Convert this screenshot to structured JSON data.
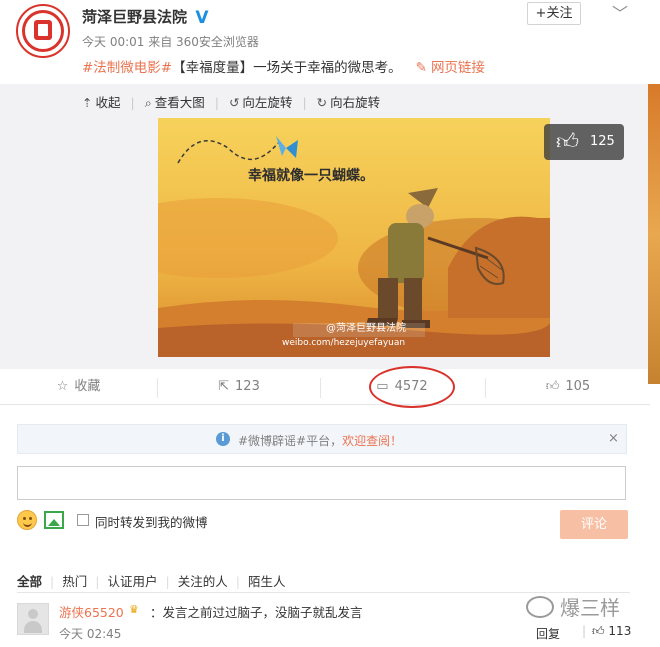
{
  "post": {
    "account_name": "菏泽巨野县法院",
    "verified_badge": "V",
    "meta": "今天 00:01 来自 360安全浏览器",
    "hashtag": "#法制微电影#",
    "text": "【幸福度量】一场关于幸福的微思考。",
    "link_label": "网页链接",
    "follow_label": "+关注",
    "more_icon": "chevron-down-icon"
  },
  "media_tools": {
    "collapse": "收起",
    "view_large": "查看大图",
    "rotate_left": "向左旋转",
    "rotate_right": "向右旋转"
  },
  "picture": {
    "caption": "幸福就像一只蝴蝶。",
    "watermark_name": "@菏泽巨野县法院",
    "watermark_url": "weibo.com/hezejuyefayuan",
    "like_count": "125"
  },
  "actions": {
    "favorite": "收藏",
    "repost_count": "123",
    "comment_count": "4572",
    "like_count": "105"
  },
  "comments": {
    "notice_text": "#微博辟谣#平台，",
    "notice_highlight": "欢迎查阅！",
    "close": "×",
    "repost_also": "同时转发到我的微博",
    "submit": "评论",
    "tabs": [
      "全部",
      "热门",
      "认证用户",
      "关注的人",
      "陌生人"
    ],
    "first": {
      "user": "游侠65520",
      "text": "：发言之前过过脑子，没脑子就乱发言",
      "time": "今天 02:45",
      "reply": "回复",
      "likes": "113"
    }
  },
  "watermark": {
    "text": "爆三样"
  },
  "colors": {
    "accent": "#eb7350",
    "link_blue": "#1e90e0",
    "highlight_circle": "#d9332b"
  }
}
